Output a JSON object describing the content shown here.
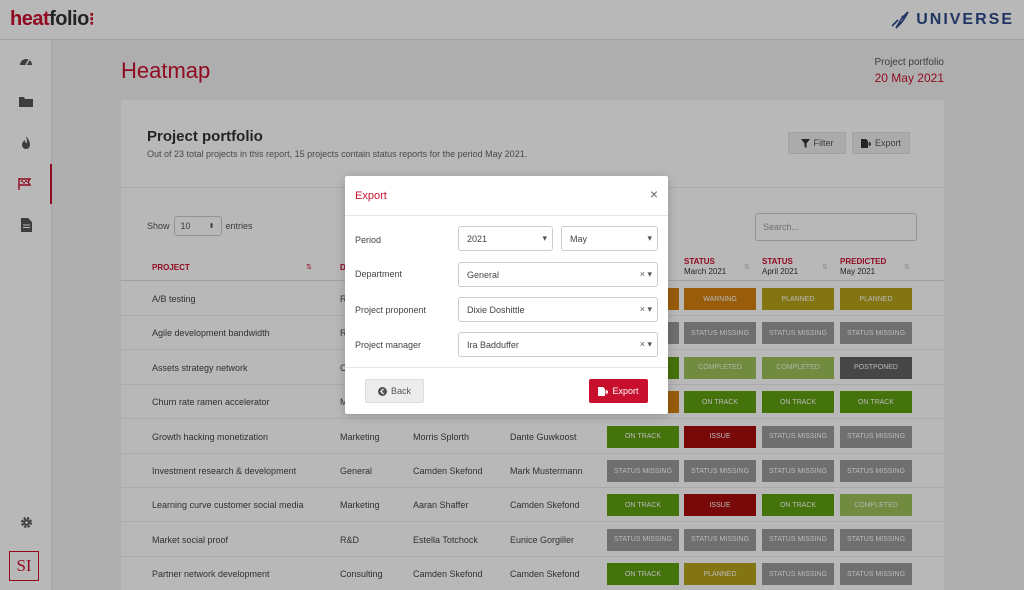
{
  "app": {
    "logo_heat": "heat",
    "logo_folio": "folio",
    "brand": "UNIVERSE"
  },
  "sidebar": {
    "icons": [
      "dashboard-icon",
      "folder-icon",
      "fire-icon",
      "flag-icon",
      "document-icon",
      "gear-icon"
    ],
    "badge": "SI"
  },
  "page": {
    "title": "Heatmap",
    "meta_label": "Project portfolio",
    "meta_date": "20 May 2021"
  },
  "card": {
    "title": "Project portfolio",
    "description": "Out of 23 total projects in this report, 15 projects contain status reports for the period May 2021.",
    "filter_label": "Filter",
    "export_label": "Export",
    "show_label": "Show",
    "entries_value": "10",
    "entries_label": "entries",
    "search_placeholder": "Search..."
  },
  "table": {
    "columns": {
      "project": "Project",
      "dept": "D",
      "s1_label": "Status",
      "s1_date": "March 2021",
      "s2_label": "Status",
      "s2_date": "April 2021",
      "s3_label": "Predicted",
      "s3_date": "May 2021"
    },
    "rows": [
      {
        "project": "A/B testing",
        "dept": "R",
        "proponent": "",
        "manager": "",
        "s0": "",
        "s1": "Warning",
        "s2": "Planned",
        "s3": "Planned"
      },
      {
        "project": "Agile development bandwidth",
        "dept": "R",
        "proponent": "",
        "manager": "",
        "s0": "",
        "s1": "Status missing",
        "s2": "Status missing",
        "s3": "Status missing"
      },
      {
        "project": "Assets strategy network",
        "dept": "C",
        "proponent": "",
        "manager": "",
        "s0": "",
        "s1": "Completed",
        "s2": "Completed",
        "s3": "Postponed"
      },
      {
        "project": "Churn rate ramen accelerator",
        "dept": "M",
        "proponent": "",
        "manager": "",
        "s0": "",
        "s1": "On track",
        "s2": "On track",
        "s3": "On track"
      },
      {
        "project": "Growth hacking monetization",
        "dept": "Marketing",
        "proponent": "Morris Splorth",
        "manager": "Dante Guwkoost",
        "s0": "On track",
        "s1": "Issue",
        "s2": "Status missing",
        "s3": "Status missing"
      },
      {
        "project": "Investment research & development",
        "dept": "General",
        "proponent": "Camden Skefond",
        "manager": "Mark Mustermann",
        "s0": "Status missing",
        "s1": "Status missing",
        "s2": "Status missing",
        "s3": "Status missing"
      },
      {
        "project": "Learning curve customer social media",
        "dept": "Marketing",
        "proponent": "Aaran Shaffer",
        "manager": "Camden Skefond",
        "s0": "On track",
        "s1": "Issue",
        "s2": "On track",
        "s3": "Completed"
      },
      {
        "project": "Market social proof",
        "dept": "R&D",
        "proponent": "Estella Totchock",
        "manager": "Eunice Gorgiller",
        "s0": "Status missing",
        "s1": "Status missing",
        "s2": "Status missing",
        "s3": "Status missing"
      },
      {
        "project": "Partner network development",
        "dept": "Consulting",
        "proponent": "Camden Skefond",
        "manager": "Camden Skefond",
        "s0": "On track",
        "s1": "Planned",
        "s2": "Status missing",
        "s3": "Status missing"
      }
    ],
    "status_colors": {
      "Warning": "#d4800f",
      "Planned": "#b5a31a",
      "Status missing": "#9a9a9a",
      "Completed": "#9dc35a",
      "Postponed": "#616161",
      "On track": "#5f9e10",
      "Issue": "#a80d0d"
    },
    "col0_partial_colors": [
      "#d4800f",
      "#9a9a9a",
      "#5f9e10",
      "#d4800f"
    ]
  },
  "modal": {
    "title": "Export",
    "close": "×",
    "period_label": "Period",
    "period_year": "2021",
    "period_month": "May",
    "department_label": "Department",
    "department_value": "General",
    "proponent_label": "Project proponent",
    "proponent_value": "Dixie Doshittle",
    "manager_label": "Project manager",
    "manager_value": "Ira Badduffer",
    "back_label": "Back",
    "export_label": "Export"
  }
}
